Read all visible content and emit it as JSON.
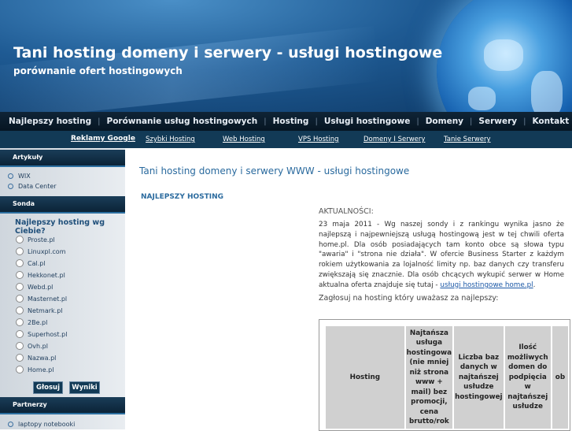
{
  "header": {
    "title": "Tani hosting domeny i serwery - usługi hostingowe",
    "subtitle": "porównanie ofert hostingowych"
  },
  "nav": {
    "items": [
      "Najlepszy hosting",
      "Porównanie usług hostingowych",
      "Hosting",
      "Usługi hostingowe",
      "Domeny",
      "Serwery",
      "Kontakt"
    ],
    "separator": "|"
  },
  "subnav": {
    "items": [
      "Reklamy Google",
      "Szybki Hosting",
      "Web Hosting",
      "VPS Hosting",
      "Domeny I Serwery",
      "Tanie Serwery"
    ]
  },
  "sidebar": {
    "articles_title": "Artykuły",
    "articles": [
      "WIX",
      "Data Center"
    ],
    "poll_title": "Sonda",
    "poll_question": "Najlepszy hosting wg Ciebie?",
    "poll_options": [
      "Proste.pl",
      "Linuxpl.com",
      "Cal.pl",
      "Hekkonet.pl",
      "Webd.pl",
      "Masternet.pl",
      "Netmark.pl",
      "2Be.pl",
      "Superhost.pl",
      "Ovh.pl",
      "Nazwa.pl",
      "Home.pl"
    ],
    "vote_button": "Głosuj",
    "results_button": "Wyniki",
    "partners_title": "Partnerzy",
    "partners": [
      "laptopy notebooki"
    ]
  },
  "main": {
    "title": "Tani hosting domeny i serwery WWW - usługi hostingowe",
    "section_title": "NAJLEPSZY HOSTING",
    "news_heading": "AKTUALNOŚCI:",
    "news_text": "23 maja 2011 - Wg naszej sondy i z rankingu wynika jasno że najlepszą i najpewniejszą usługą hostingową jest w tej chwili oferta home.pl. Dla osób posiadających tam konto obce są słowa typu \"awaria\" i \"strona nie działa\". W ofercie Business Starter z każdym rokiem użytkowania za lojalność limity np. baz danych czy transferu zwiększają się znacznie. Dla osób chcących wykupić serwer w Home aktualna oferta znajduje się tutaj - ",
    "news_link": "usługi hostingowe home.pl",
    "news_end": ".",
    "vote_prompt": "Zagłosuj na hosting który uważasz za najlepszy:",
    "table_headers": [
      "Hosting",
      "Najtańsza usługa hostingowa (nie mniej niż strona www + mail) bez promocji, cena brutto/rok",
      "Liczba baz danych w najtańszej usłudze hostingowej",
      "Ilość możliwych domen do podpięcia w najtańszej usłudze",
      "ob"
    ]
  },
  "colors": {
    "nav_bg": "#0b1d2c",
    "subnav_bg": "#123a56",
    "title_blue": "#2a6a9e",
    "link_blue": "#1a57a6"
  }
}
